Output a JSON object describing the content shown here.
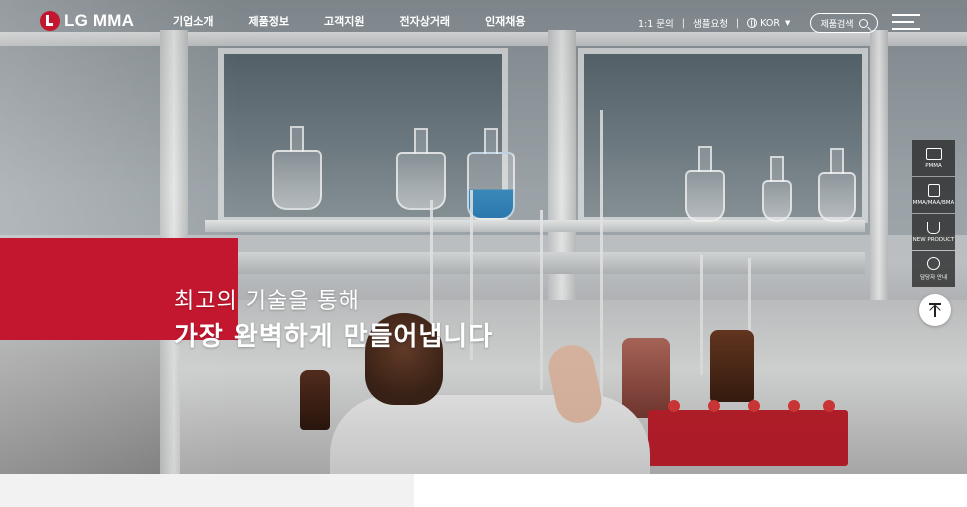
{
  "header": {
    "logo_text": "LG MMA",
    "nav": [
      "기업소개",
      "제품정보",
      "고객지원",
      "전자상거래",
      "인재채용"
    ],
    "util": {
      "inquiry": "1:1 문의",
      "sample": "샘플요청",
      "language": "KOR"
    },
    "search_label": "제품검색"
  },
  "hero": {
    "line1": "최고의 기술을 통해",
    "line2": "가장 완벽하게 만들어냅니다",
    "accent_color": "#c3172f"
  },
  "quick_menu": [
    {
      "label": "PMMA",
      "icon": "book-icon"
    },
    {
      "label": "MMA/MAA/BMA",
      "icon": "document-icon"
    },
    {
      "label": "NEW PRODUCT",
      "icon": "beaker-icon"
    },
    {
      "label": "담당자 안내",
      "icon": "contact-icon"
    }
  ],
  "top_button_icon": "arrow-up-icon"
}
